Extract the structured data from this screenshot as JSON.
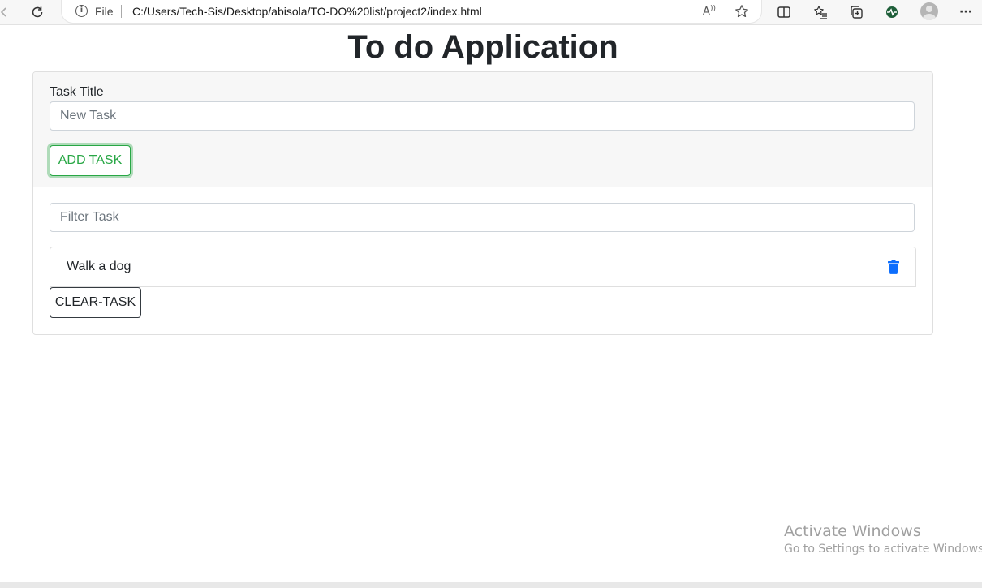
{
  "browser": {
    "file_label": "File",
    "url": "C:/Users/Tech-Sis/Desktop/abisola/TO-DO%20list/project2/index.html",
    "icons": {
      "back": "back-arrow-icon",
      "refresh": "refresh-icon",
      "info": "info-icon",
      "read_aloud": "read-aloud-icon",
      "favorite": "favorite-star-icon",
      "split_screen": "split-screen-icon",
      "favorites": "favorites-list-icon",
      "collections": "collections-icon",
      "extension": "extension-icon",
      "profile": "profile-avatar",
      "more": "more-menu-icon"
    },
    "more_glyph": "···",
    "info_glyph": "i",
    "read_aloud_glyph": "A"
  },
  "app": {
    "title": "To do Application",
    "form": {
      "label": "Task Title",
      "placeholder": "New Task",
      "value": "",
      "add_button_label": "ADD TASK"
    },
    "filter": {
      "placeholder": "Filter Task",
      "value": ""
    },
    "tasks": [
      {
        "text": "Walk a dog"
      }
    ],
    "clear_button_label": "CLEAR-TASK",
    "colors": {
      "add_button": "#28a745",
      "delete_icon": "#0d6efd",
      "clear_button_border": "#343a40"
    }
  },
  "watermark": {
    "title": "Activate Windows",
    "subtitle": "Go to Settings to activate Windows."
  }
}
